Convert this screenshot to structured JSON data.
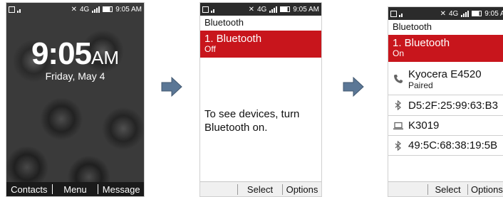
{
  "lock_screen": {
    "time": "9:05",
    "ampm": "AM",
    "date": "Friday, May 4",
    "softkeys": [
      "Contacts",
      "Menu",
      "Message"
    ]
  },
  "status_bar": {
    "time": "9:05 AM",
    "network": "4G"
  },
  "bluetooth_off": {
    "title": "Bluetooth",
    "item_label": "1. Bluetooth",
    "item_state": "Off",
    "message": "To see devices, turn Bluetooth on.",
    "softkeys": [
      "Select",
      "Options"
    ]
  },
  "bluetooth_on": {
    "title": "Bluetooth",
    "item_label": "1. Bluetooth",
    "item_state": "On",
    "devices": [
      {
        "name": "Kyocera E4520",
        "status": "Paired",
        "icon": "phone-icon"
      },
      {
        "name": "D5:2F:25:99:63:B3",
        "status": "",
        "icon": "bluetooth-icon"
      },
      {
        "name": "K3019",
        "status": "",
        "icon": "laptop-icon"
      },
      {
        "name": "49:5C:68:38:19:5B",
        "status": "",
        "icon": "bluetooth-icon"
      }
    ],
    "softkeys": [
      "Select",
      "Options"
    ]
  },
  "colors": {
    "accent": "#c8151c",
    "arrow": "#5b7796"
  }
}
